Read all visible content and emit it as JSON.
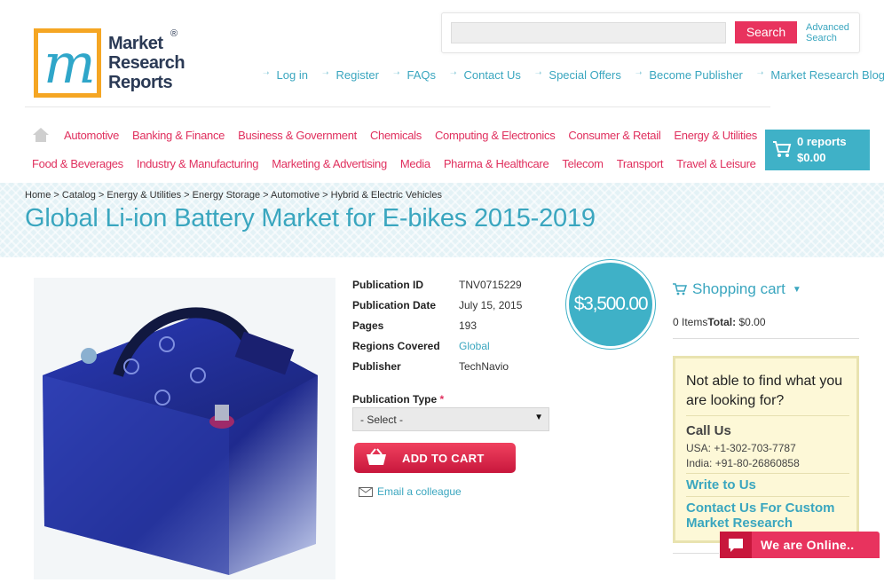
{
  "logo": {
    "line1": "Market",
    "line2": "Research",
    "line3": "Reports",
    "reg": "®",
    "glyph": "m"
  },
  "search": {
    "placeholder": "",
    "button": "Search",
    "advanced_line1": "Advanced",
    "advanced_line2": "Search"
  },
  "toplinks": [
    "Log in",
    "Register",
    "FAQs",
    "Contact Us",
    "Special Offers",
    "Become Publisher",
    "Market Research Blog"
  ],
  "categories_row1": [
    "Automotive",
    "Banking & Finance",
    "Business & Government",
    "Chemicals",
    "Computing & Electronics",
    "Consumer & Retail",
    "Energy & Utilities"
  ],
  "categories_row2": [
    "Food & Beverages",
    "Industry & Manufacturing",
    "Marketing & Advertising",
    "Media",
    "Pharma & Healthcare",
    "Telecom",
    "Transport",
    "Travel & Leisure"
  ],
  "cart": {
    "count": "0 reports",
    "total": "$0.00"
  },
  "breadcrumb": [
    "Home",
    "Catalog",
    "Energy & Utilities",
    "Energy Storage",
    "Automotive",
    "Hybrid & Electric Vehicles"
  ],
  "breadcrumb_sep": " > ",
  "page_title": "Global Li-ion Battery Market for E-bikes 2015-2019",
  "specs": [
    {
      "key": "Publication ID",
      "value": "TNV0715229"
    },
    {
      "key": "Publication Date",
      "value": "July 15, 2015"
    },
    {
      "key": "Pages",
      "value": "193"
    },
    {
      "key": "Regions Covered",
      "value": "Global"
    },
    {
      "key": "Publisher",
      "value": "TechNavio"
    }
  ],
  "price": "$3,500.00",
  "publication_type": {
    "label": "Publication Type",
    "required": "*",
    "selected": "- Select -"
  },
  "add_to_cart": "ADD TO CART",
  "email_colleague": "Email a colleague",
  "shopping_cart": {
    "title": "Shopping cart",
    "items": "0 Items",
    "total_label": "Total:",
    "total_value": "$0.00"
  },
  "help": {
    "title": "Not able to find what you are looking for?",
    "call_us": "Call Us",
    "usa": "USA: +1-302-703-7787",
    "india": "India: +91-80-26860858",
    "write_to_us": "Write to Us",
    "custom": "Contact Us For Custom Market Research"
  },
  "chat": "We are Online..",
  "colors": {
    "accent": "#3aa6bf",
    "pink": "#e0305e",
    "cart_bg": "#3fb1c7"
  }
}
